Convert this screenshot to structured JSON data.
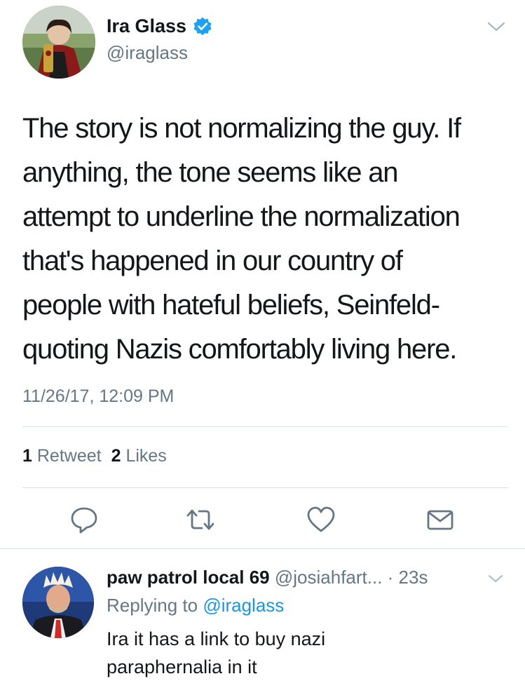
{
  "tweet": {
    "author": {
      "display_name": "Ira Glass",
      "handle": "@iraglass",
      "verified": true
    },
    "text_lines": [
      "The story is not normalizing the guy. If",
      "anything, the tone seems like an",
      "attempt to underline the normalization",
      "that's happened in our country of",
      "people with hateful beliefs, Seinfeld-",
      "quoting Nazis comfortably living here."
    ],
    "timestamp": "11/26/17, 12:09 PM",
    "stats": {
      "retweets_count": "1",
      "retweets_label": "Retweet",
      "likes_count": "2",
      "likes_label": "Likes"
    },
    "actions": [
      "reply-icon",
      "retweet-icon",
      "like-icon",
      "message-icon"
    ]
  },
  "reply": {
    "display_name": "paw patrol local 69",
    "handle": "@josiahfart...",
    "time": "· 23s",
    "replying_label": "Replying to",
    "replying_to": "@iraglass",
    "text_lines": [
      "Ira it has a link to buy nazi",
      "paraphernalia in it"
    ]
  },
  "colors": {
    "text": "#14171a",
    "secondary": "#657786",
    "link": "#1b95e0",
    "verified": "#1da1f2",
    "divider": "#d8dde2"
  }
}
